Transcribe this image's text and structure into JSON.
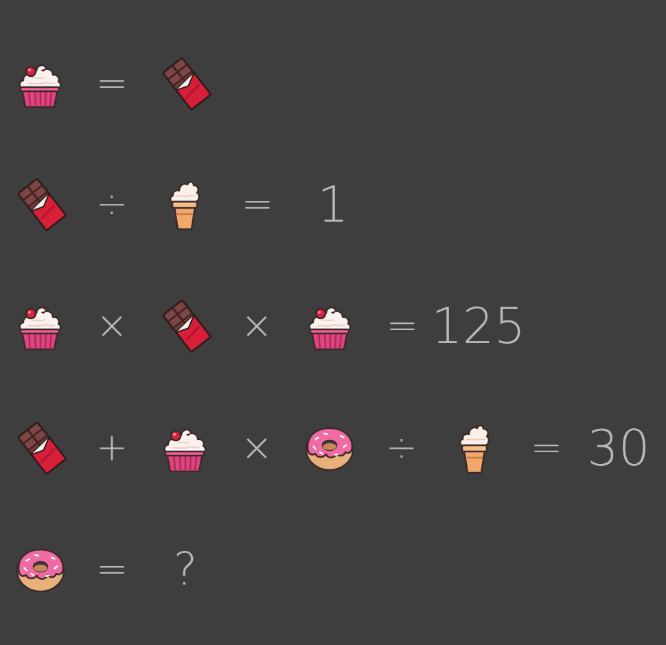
{
  "puzzle": {
    "rows": [
      {
        "tokens": [
          {
            "icon": "cupcake-icon"
          },
          {
            "text": "="
          },
          {
            "icon": "chocolate-bar-icon"
          }
        ]
      },
      {
        "tokens": [
          {
            "icon": "chocolate-bar-icon"
          },
          {
            "text": "÷"
          },
          {
            "icon": "ice-cream-cone-icon"
          },
          {
            "text": "="
          },
          {
            "text": "1"
          }
        ]
      },
      {
        "tokens": [
          {
            "icon": "cupcake-icon"
          },
          {
            "text": "×"
          },
          {
            "icon": "chocolate-bar-icon"
          },
          {
            "text": "×"
          },
          {
            "icon": "cupcake-icon"
          },
          {
            "text": "="
          },
          {
            "text": "125"
          }
        ]
      },
      {
        "tokens": [
          {
            "icon": "chocolate-bar-icon"
          },
          {
            "text": "+"
          },
          {
            "icon": "cupcake-icon"
          },
          {
            "text": "×"
          },
          {
            "icon": "donut-icon"
          },
          {
            "text": "÷"
          },
          {
            "icon": "ice-cream-cone-icon"
          },
          {
            "text": "="
          },
          {
            "text": "30"
          }
        ]
      },
      {
        "tokens": [
          {
            "icon": "donut-icon"
          },
          {
            "text": "="
          },
          {
            "text": "?"
          }
        ]
      }
    ]
  },
  "colors": {
    "background": "#3e3e3e",
    "symbol_text": "#b8b8b8"
  }
}
